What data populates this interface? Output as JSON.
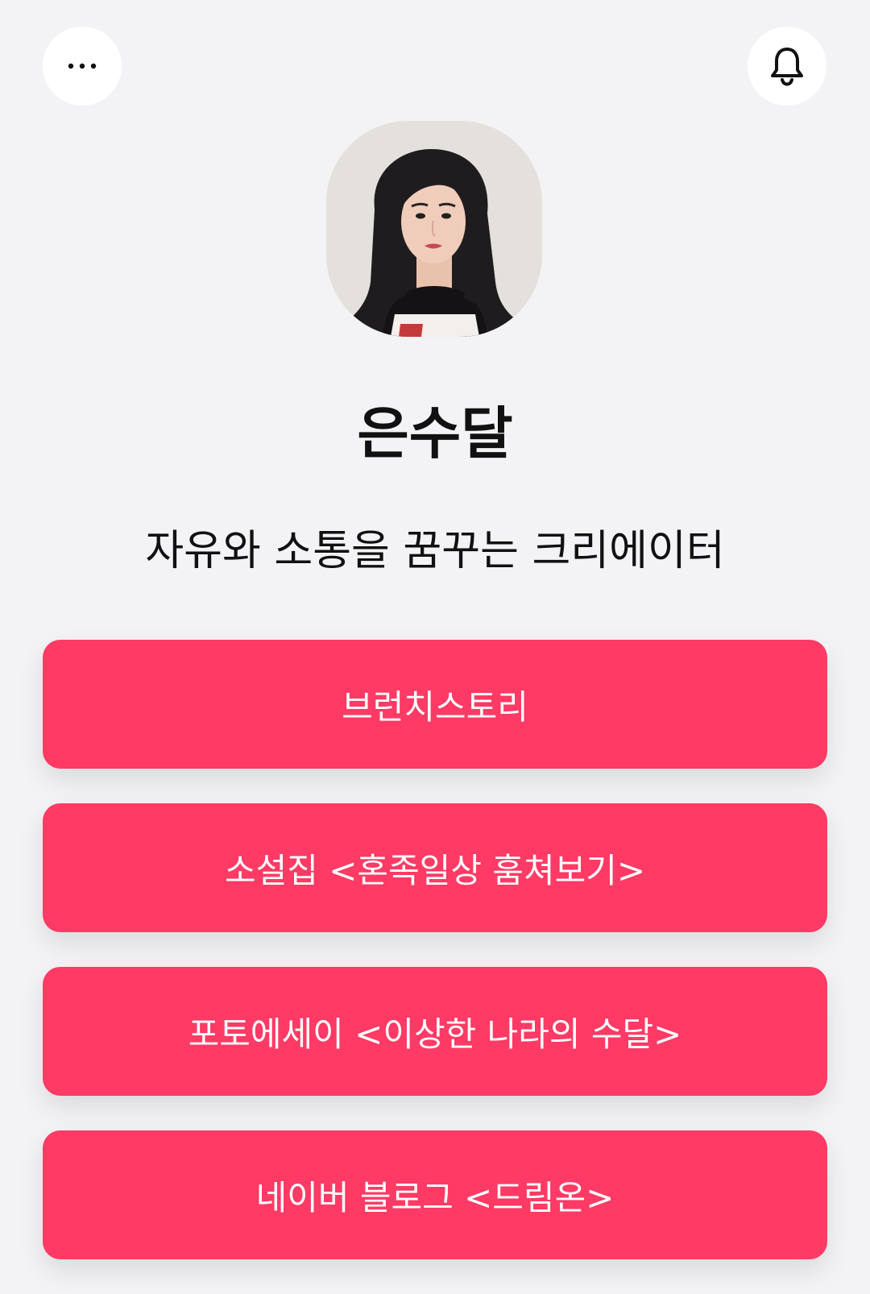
{
  "header": {
    "more_icon": "more-horizontal-icon",
    "bell_icon": "bell-icon"
  },
  "profile": {
    "name": "은수달",
    "bio": "자유와 소통을 꿈꾸는 크리에이터"
  },
  "links": [
    {
      "label": "브런치스토리"
    },
    {
      "label": "소설집 <혼족일상 훔쳐보기>"
    },
    {
      "label": "포토에세이 <이상한 나라의 수달>"
    },
    {
      "label": "네이버 블로그 <드림온>"
    }
  ],
  "colors": {
    "background": "#f3f3f6",
    "accent": "#ff3a64"
  }
}
